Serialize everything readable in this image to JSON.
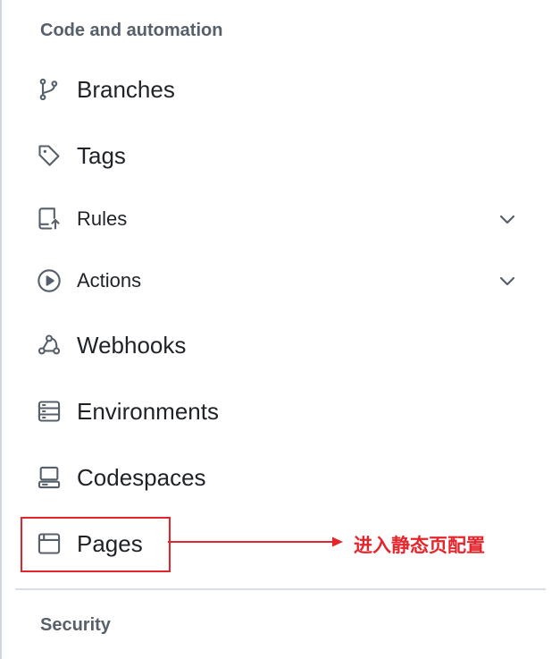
{
  "sections": {
    "code_automation": "Code and automation",
    "security": "Security"
  },
  "nav": {
    "branches": {
      "label": "Branches",
      "icon": "git-branch-icon"
    },
    "tags": {
      "label": "Tags",
      "icon": "tag-icon"
    },
    "rules": {
      "label": "Rules",
      "icon": "repo-push-icon"
    },
    "actions": {
      "label": "Actions",
      "icon": "play-icon"
    },
    "webhooks": {
      "label": "Webhooks",
      "icon": "webhook-icon"
    },
    "environments": {
      "label": "Environments",
      "icon": "server-icon"
    },
    "codespaces": {
      "label": "Codespaces",
      "icon": "codespaces-icon"
    },
    "pages": {
      "label": "Pages",
      "icon": "browser-icon"
    }
  },
  "annotation": {
    "text": "进入静态页配置",
    "color": "#e5252c"
  },
  "colors": {
    "text": "#1f2328",
    "muted": "#57606a",
    "highlight": "#e5252c"
  }
}
